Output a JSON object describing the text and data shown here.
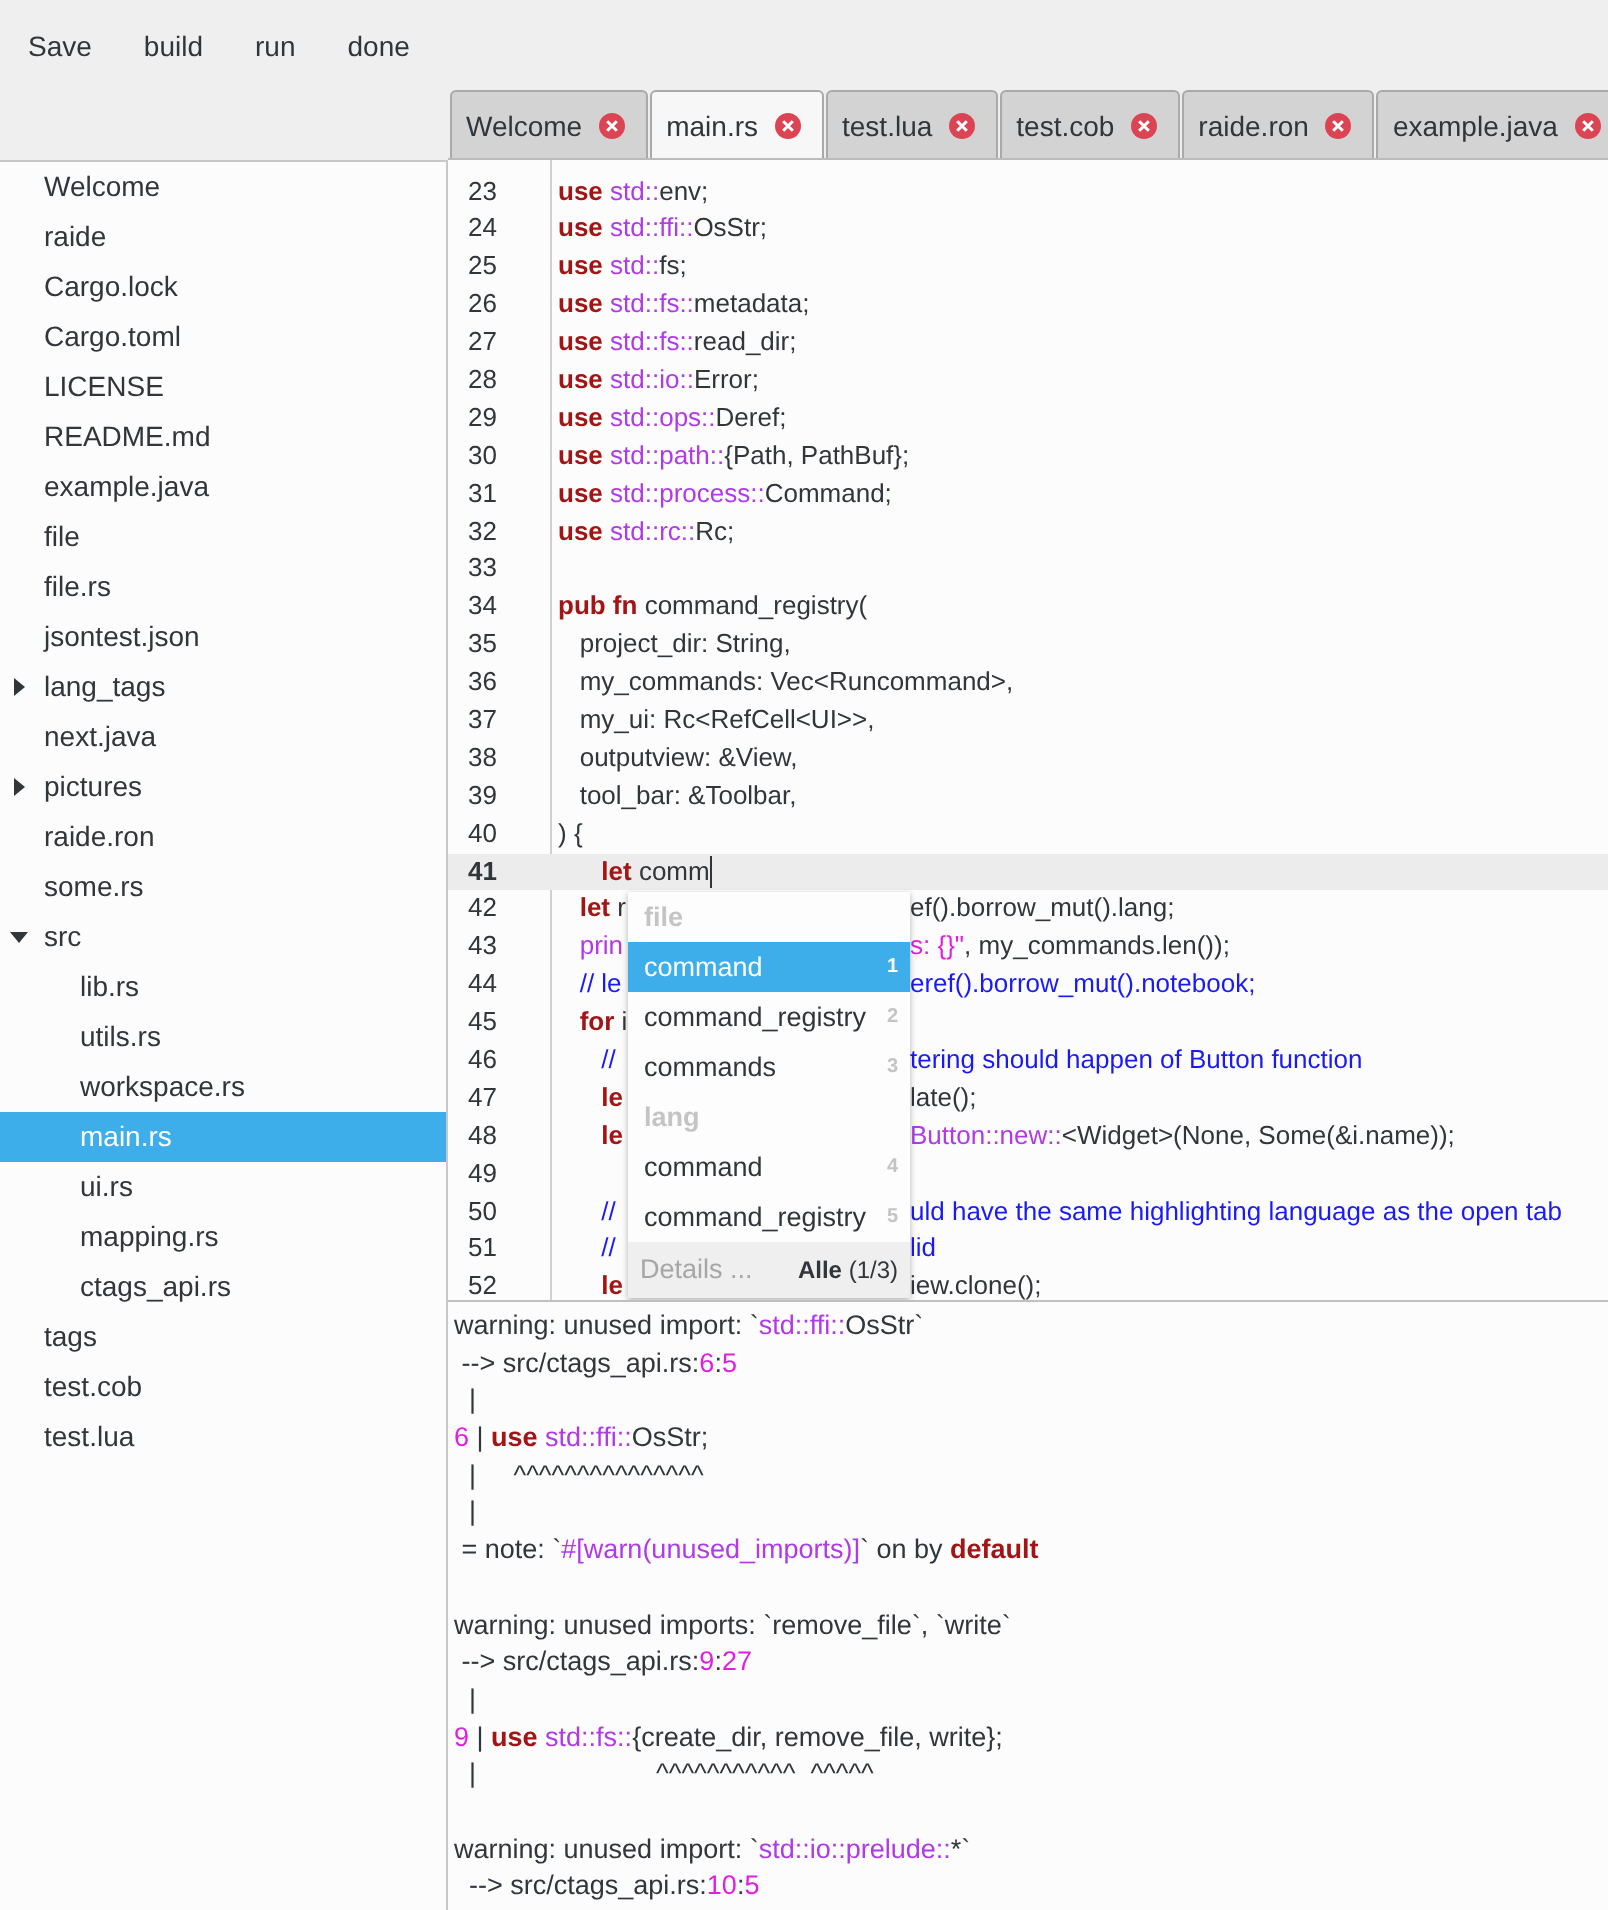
{
  "menu": [
    "Save",
    "build",
    "run",
    "done"
  ],
  "tabs": [
    {
      "label": "Welcome",
      "selected": false
    },
    {
      "label": "main.rs",
      "selected": true
    },
    {
      "label": "test.lua",
      "selected": false
    },
    {
      "label": "test.cob",
      "selected": false
    },
    {
      "label": "raide.ron",
      "selected": false
    },
    {
      "label": "example.java",
      "selected": false
    }
  ],
  "sidebar": {
    "items": [
      {
        "label": "Welcome",
        "selected": false
      },
      {
        "label": "raide",
        "selected": false
      },
      {
        "label": "Cargo.lock",
        "selected": false
      },
      {
        "label": "Cargo.toml",
        "selected": false
      },
      {
        "label": "LICENSE",
        "selected": false
      },
      {
        "label": "README.md",
        "selected": false
      },
      {
        "label": "example.java",
        "selected": false
      },
      {
        "label": "file",
        "selected": false
      },
      {
        "label": "file.rs",
        "selected": false
      },
      {
        "label": "jsontest.json",
        "selected": false
      },
      {
        "label": "lang_tags",
        "selected": false,
        "expanded": false
      },
      {
        "label": "next.java",
        "selected": false
      },
      {
        "label": "pictures",
        "selected": false,
        "expanded": false
      },
      {
        "label": "raide.ron",
        "selected": false
      },
      {
        "label": "some.rs",
        "selected": false
      },
      {
        "label": "src",
        "selected": false,
        "expanded": true,
        "children": [
          {
            "label": "lib.rs",
            "selected": false
          },
          {
            "label": "utils.rs",
            "selected": false
          },
          {
            "label": "workspace.rs",
            "selected": false
          },
          {
            "label": "main.rs",
            "selected": true
          },
          {
            "label": "ui.rs",
            "selected": false
          },
          {
            "label": "mapping.rs",
            "selected": false
          },
          {
            "label": "ctags_api.rs",
            "selected": false
          }
        ]
      },
      {
        "label": "tags",
        "selected": false
      },
      {
        "label": "test.cob",
        "selected": false
      },
      {
        "label": "test.lua",
        "selected": false
      }
    ]
  },
  "editor": {
    "lines": [
      {
        "number": "23",
        "current": false,
        "tokens": [
          {
            "kind": "kw",
            "text": "use"
          },
          {
            "kind": "path",
            "text": " std::"
          },
          {
            "kind": "plain",
            "text": "env;"
          }
        ]
      },
      {
        "number": "24",
        "current": false,
        "tokens": [
          {
            "kind": "kw",
            "text": "use"
          },
          {
            "kind": "path",
            "text": " std::ffi::"
          },
          {
            "kind": "plain",
            "text": "OsStr;"
          }
        ]
      },
      {
        "number": "25",
        "current": false,
        "tokens": [
          {
            "kind": "kw",
            "text": "use"
          },
          {
            "kind": "path",
            "text": " std::"
          },
          {
            "kind": "plain",
            "text": "fs;"
          }
        ]
      },
      {
        "number": "26",
        "current": false,
        "tokens": [
          {
            "kind": "kw",
            "text": "use"
          },
          {
            "kind": "path",
            "text": " std::fs::"
          },
          {
            "kind": "plain",
            "text": "metadata;"
          }
        ]
      },
      {
        "number": "27",
        "current": false,
        "tokens": [
          {
            "kind": "kw",
            "text": "use"
          },
          {
            "kind": "path",
            "text": " std::fs::"
          },
          {
            "kind": "plain",
            "text": "read_dir;"
          }
        ]
      },
      {
        "number": "28",
        "current": false,
        "tokens": [
          {
            "kind": "kw",
            "text": "use"
          },
          {
            "kind": "path",
            "text": " std::io::"
          },
          {
            "kind": "plain",
            "text": "Error;"
          }
        ]
      },
      {
        "number": "29",
        "current": false,
        "tokens": [
          {
            "kind": "kw",
            "text": "use"
          },
          {
            "kind": "path",
            "text": " std::ops::"
          },
          {
            "kind": "plain",
            "text": "Deref;"
          }
        ]
      },
      {
        "number": "30",
        "current": false,
        "tokens": [
          {
            "kind": "kw",
            "text": "use"
          },
          {
            "kind": "path",
            "text": " std::path::"
          },
          {
            "kind": "plain",
            "text": "{Path, PathBuf};"
          }
        ]
      },
      {
        "number": "31",
        "current": false,
        "tokens": [
          {
            "kind": "kw",
            "text": "use"
          },
          {
            "kind": "path",
            "text": " std::process::"
          },
          {
            "kind": "plain",
            "text": "Command;"
          }
        ]
      },
      {
        "number": "32",
        "current": false,
        "tokens": [
          {
            "kind": "kw",
            "text": "use"
          },
          {
            "kind": "path",
            "text": " std::rc::"
          },
          {
            "kind": "plain",
            "text": "Rc;"
          }
        ]
      },
      {
        "number": "33",
        "current": false
      },
      {
        "number": "34",
        "current": false,
        "tokens": [
          {
            "kind": "kw",
            "text": "pub fn"
          },
          {
            "kind": "plain",
            "text": " command_registry("
          }
        ]
      },
      {
        "number": "35",
        "current": false,
        "tokens": [
          {
            "kind": "plain",
            "text": "   project_dir: String,"
          }
        ]
      },
      {
        "number": "36",
        "current": false,
        "tokens": [
          {
            "kind": "plain",
            "text": "   my_commands: Vec<Runcommand>,"
          }
        ]
      },
      {
        "number": "37",
        "current": false,
        "tokens": [
          {
            "kind": "plain",
            "text": "   my_ui: Rc<RefCell<UI>>,"
          }
        ]
      },
      {
        "number": "38",
        "current": false,
        "tokens": [
          {
            "kind": "plain",
            "text": "   outputview: &View,"
          }
        ]
      },
      {
        "number": "39",
        "current": false,
        "tokens": [
          {
            "kind": "plain",
            "text": "   tool_bar: &Toolbar,"
          }
        ]
      },
      {
        "number": "40",
        "current": false,
        "tokens": [
          {
            "kind": "plain",
            "text": ") {"
          }
        ]
      },
      {
        "number": "41",
        "current": true,
        "tokens": [
          {
            "kind": "kw",
            "text": "      let"
          },
          {
            "kind": "plain",
            "text": " comm"
          }
        ]
      },
      {
        "number": "42",
        "current": false,
        "tokens": [
          {
            "kind": "kw",
            "text": "   let"
          },
          {
            "kind": "plain",
            "text": " r"
          }
        ],
        "after_popup": [
          {
            "kind": "plain",
            "text": "ef().borrow_mut().lang;"
          }
        ]
      },
      {
        "number": "43",
        "current": false,
        "tokens": [
          {
            "kind": "path",
            "text": "   prin"
          }
        ],
        "after_popup": [
          {
            "kind": "string",
            "text": "s: {}\""
          },
          {
            "kind": "plain",
            "text": ", my_commands.len());"
          }
        ]
      },
      {
        "number": "44",
        "current": false,
        "tokens": [
          {
            "kind": "comment",
            "text": "   // le"
          }
        ],
        "after_popup": [
          {
            "kind": "comment",
            "text": "eref().borrow_mut().notebook;"
          }
        ]
      },
      {
        "number": "45",
        "current": false,
        "tokens": [
          {
            "kind": "kw",
            "text": "   for"
          },
          {
            "kind": "plain",
            "text": " i"
          }
        ]
      },
      {
        "number": "46",
        "current": false,
        "tokens": [
          {
            "kind": "comment",
            "text": "      //"
          }
        ],
        "after_popup": [
          {
            "kind": "comment",
            "text": "tering should happen of Button function"
          }
        ]
      },
      {
        "number": "47",
        "current": false,
        "tokens": [
          {
            "kind": "kw",
            "text": "      le"
          }
        ],
        "after_popup": [
          {
            "kind": "plain",
            "text": "late();"
          }
        ]
      },
      {
        "number": "48",
        "current": false,
        "tokens": [
          {
            "kind": "kw",
            "text": "      le"
          }
        ],
        "after_popup": [
          {
            "kind": "path",
            "text": "Button::new::"
          },
          {
            "kind": "plain",
            "text": "<Widget>(None, Some(&i.name));"
          }
        ]
      },
      {
        "number": "49",
        "current": false
      },
      {
        "number": "50",
        "current": false,
        "tokens": [
          {
            "kind": "comment",
            "text": "      //"
          }
        ],
        "after_popup": [
          {
            "kind": "comment",
            "text": "uld have the same highlighting language as the open tab"
          }
        ]
      },
      {
        "number": "51",
        "current": false,
        "tokens": [
          {
            "kind": "comment",
            "text": "      //"
          }
        ],
        "after_popup": [
          {
            "kind": "comment",
            "text": "lid"
          }
        ]
      },
      {
        "number": "52",
        "current": false,
        "tokens": [
          {
            "kind": "kw",
            "text": "      le"
          }
        ],
        "after_popup": [
          {
            "kind": "plain",
            "text": "iew.clone();"
          }
        ]
      }
    ],
    "completion": {
      "items": [
        {
          "kind": "header",
          "label": "file"
        },
        {
          "kind": "item",
          "label": "command",
          "number": "1",
          "selected": true
        },
        {
          "kind": "item",
          "label": "command_registry",
          "number": "2",
          "selected": false
        },
        {
          "kind": "item",
          "label": "commands",
          "number": "3",
          "selected": false
        },
        {
          "kind": "header",
          "label": "lang"
        },
        {
          "kind": "item",
          "label": "command",
          "number": "4",
          "selected": false
        },
        {
          "kind": "item",
          "label": "command_registry",
          "number": "5",
          "selected": false
        }
      ],
      "details": "Details ...",
      "filter": "**Alle** (1/3)"
    }
  },
  "output": {
    "messages": [
      [
        [
          {
            "kind": "plain",
            "text": "warning: unused import: `"
          },
          {
            "kind": "path",
            "text": "std::ffi::"
          },
          {
            "kind": "plain",
            "text": "OsStr`"
          }
        ],
        [
          {
            "kind": "plain",
            "text": " --> src/ctags_api.rs:"
          },
          {
            "kind": "number",
            "text": "6"
          },
          {
            "kind": "plain",
            "text": ":"
          },
          {
            "kind": "number",
            "text": "5"
          }
        ],
        [
          {
            "kind": "plain",
            "text": "  |"
          }
        ],
        [
          {
            "kind": "number",
            "text": "6"
          },
          {
            "kind": "plain",
            "text": " | "
          },
          {
            "kind": "kw",
            "text": "use"
          },
          {
            "kind": "path",
            "text": " std::ffi::"
          },
          {
            "kind": "plain",
            "text": "OsStr;"
          }
        ],
        [
          {
            "kind": "plain",
            "text": "  |     ^^^^^^^^^^^^^^^"
          }
        ],
        [
          {
            "kind": "plain",
            "text": "  |"
          }
        ],
        [
          {
            "kind": "plain",
            "text": " = note: `"
          },
          {
            "kind": "path",
            "text": "#[warn(unused_imports)]"
          },
          {
            "kind": "plain",
            "text": "` on by "
          },
          {
            "kind": "kw",
            "text": "default"
          }
        ]
      ],
      [
        [
          {
            "kind": "plain",
            "text": "warning: unused imports: `remove_file`, `write`"
          }
        ],
        [
          {
            "kind": "plain",
            "text": " --> src/ctags_api.rs:"
          },
          {
            "kind": "number",
            "text": "9"
          },
          {
            "kind": "plain",
            "text": ":"
          },
          {
            "kind": "number",
            "text": "27"
          }
        ],
        [
          {
            "kind": "plain",
            "text": "  |"
          }
        ],
        [
          {
            "kind": "number",
            "text": "9"
          },
          {
            "kind": "plain",
            "text": " | "
          },
          {
            "kind": "kw",
            "text": "use"
          },
          {
            "kind": "path",
            "text": " std::fs::"
          },
          {
            "kind": "plain",
            "text": "{create_dir, remove_file, write};"
          }
        ],
        [
          {
            "kind": "plain",
            "text": "  |                        ^^^^^^^^^^^  ^^^^^"
          }
        ]
      ],
      [
        [
          {
            "kind": "plain",
            "text": "warning: unused import: `"
          },
          {
            "kind": "path",
            "text": "std::io::prelude::"
          },
          {
            "kind": "plain",
            "text": "*`"
          }
        ],
        [
          {
            "kind": "plain",
            "text": "  --> src/ctags_api.rs:"
          },
          {
            "kind": "number",
            "text": "10"
          },
          {
            "kind": "plain",
            "text": ":"
          },
          {
            "kind": "number",
            "text": "5"
          }
        ]
      ]
    ]
  }
}
